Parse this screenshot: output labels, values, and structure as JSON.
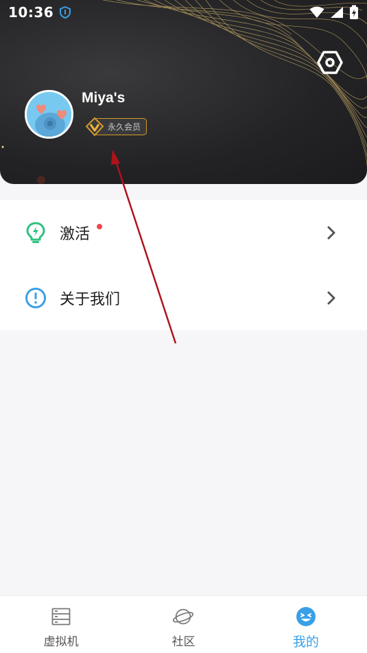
{
  "status_bar": {
    "time": "10:36",
    "icons": [
      "app-notification-icon",
      "wifi-icon",
      "signal-icon",
      "battery-charging-icon"
    ]
  },
  "profile": {
    "username": "Miya's",
    "membership_badge": "永久会员",
    "avatar": "avatar-cartoon-character",
    "settings_icon": "settings-hexagon-icon"
  },
  "menu": {
    "items": [
      {
        "label": "激活",
        "icon": "lightbulb-lightning-icon",
        "icon_color": "#2ec27e",
        "has_dot": true
      },
      {
        "label": "关于我们",
        "icon": "info-exclamation-icon",
        "icon_color": "#39a0e8",
        "has_dot": false
      }
    ]
  },
  "bottom_nav": {
    "items": [
      {
        "label": "虚拟机",
        "icon": "server-icon",
        "active": false
      },
      {
        "label": "社区",
        "icon": "planet-icon",
        "active": false
      },
      {
        "label": "我的",
        "icon": "smiley-face-icon",
        "active": true
      }
    ]
  },
  "colors": {
    "accent": "#39a0e8",
    "badge_border": "#d59a2a",
    "notification_dot": "#f0474f",
    "header_bg": "#232325",
    "annotation_arrow": "#b0121b"
  }
}
